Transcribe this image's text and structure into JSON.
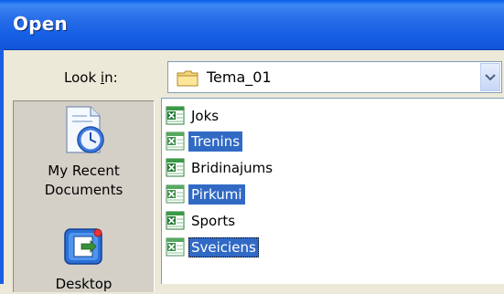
{
  "window": {
    "title": "Open"
  },
  "lookin": {
    "label_before": "Look ",
    "label_accel": "i",
    "label_after": "n:",
    "value": "Tema_01"
  },
  "places": [
    {
      "label_line1": "My Recent",
      "label_line2": "Documents",
      "icon": "recent-documents-icon"
    },
    {
      "label_line1": "Desktop",
      "icon": "desktop-icon"
    }
  ],
  "files": [
    {
      "name": "Joks",
      "selected": false
    },
    {
      "name": "Trenins",
      "selected": true
    },
    {
      "name": "Bridinajums",
      "selected": false
    },
    {
      "name": "Pirkumi",
      "selected": true
    },
    {
      "name": "Sports",
      "selected": false
    },
    {
      "name": "Sveiciens",
      "selected": true
    }
  ],
  "colors": {
    "titlebar": "#1660e6",
    "selection": "#316AC5",
    "dialog_bg": "#ECE9D8",
    "excel_green": "#1d7a2e"
  }
}
